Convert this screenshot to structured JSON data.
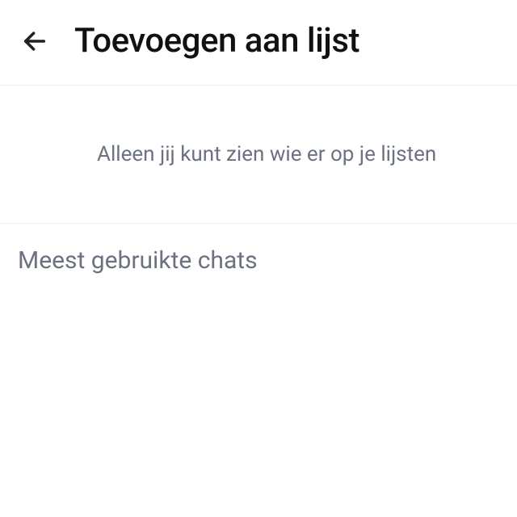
{
  "header": {
    "title": "Toevoegen aan lijst"
  },
  "info": {
    "text": "Alleen jij kunt zien wie er op je lijsten"
  },
  "section": {
    "title": "Meest gebruikte chats"
  }
}
